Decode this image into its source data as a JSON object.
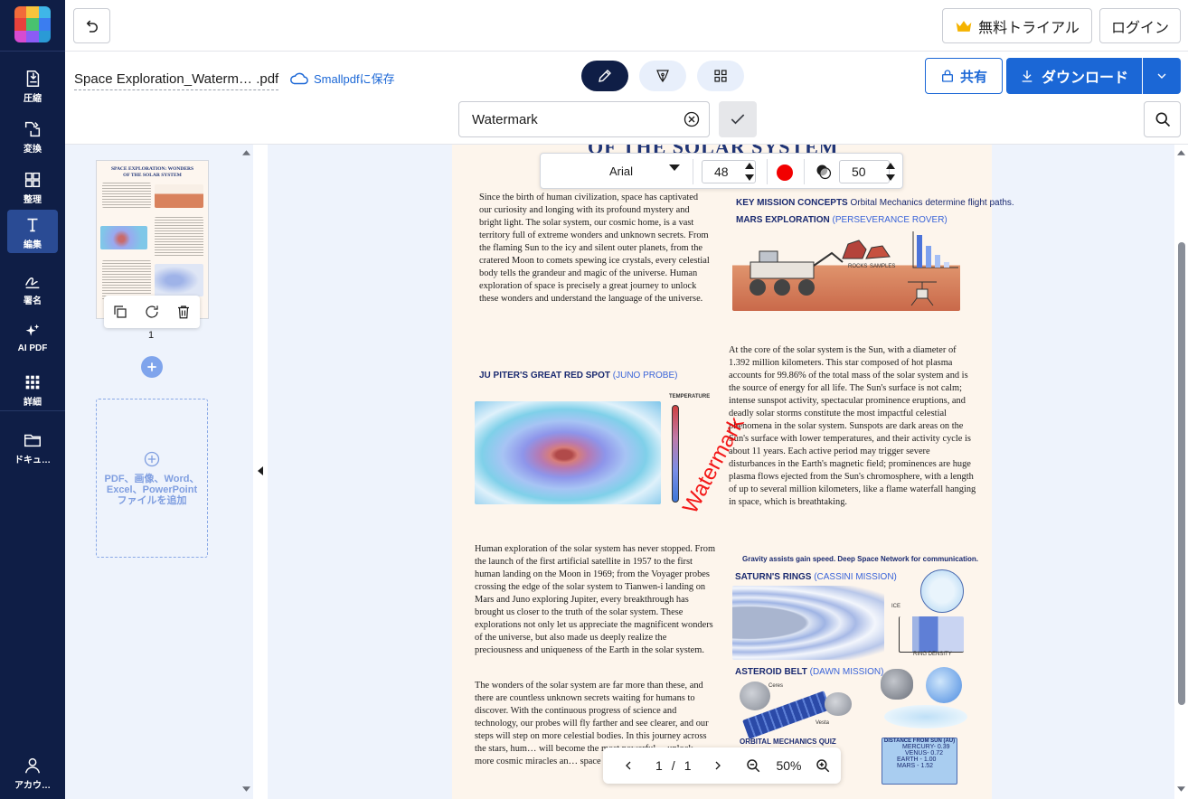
{
  "nav": {
    "items": [
      {
        "label": "圧縮",
        "icon": "compress-icon"
      },
      {
        "label": "変換",
        "icon": "convert-icon"
      },
      {
        "label": "整理",
        "icon": "organize-icon"
      },
      {
        "label": "編集",
        "icon": "edit-icon",
        "active": true
      },
      {
        "label": "署名",
        "icon": "sign-icon"
      },
      {
        "label": "AI PDF",
        "icon": "ai-sparkle-icon"
      },
      {
        "label": "詳細",
        "icon": "more-grid-icon"
      },
      {
        "label": "ドキュ…",
        "icon": "folder-icon"
      }
    ],
    "account_label": "アカウ…"
  },
  "topbar": {
    "trial_label": "無料トライアル",
    "login_label": "ログイン"
  },
  "file": {
    "name": "Space Exploration_Waterm… .pdf",
    "save_label": "Smallpdfに保存"
  },
  "actions": {
    "share_label": "共有",
    "download_label": "ダウンロード"
  },
  "watermark": {
    "value": "Watermark",
    "rendered_text": "Watermark"
  },
  "format": {
    "font": "Arial",
    "size": "48",
    "color": "#f20000",
    "opacity": "50"
  },
  "thumbs": {
    "page_number": "1",
    "add_label": "PDF、画像、Word、Excel、PowerPointファイルを追加"
  },
  "pager": {
    "current": "1",
    "separator": "/",
    "total": "1",
    "zoom": "50%"
  },
  "doc": {
    "title": "OF THE SOLAR SYSTEM",
    "thumb_title": "SPACE EXPLORATION: WONDERS OF THE SOLAR SYSTEM",
    "para1": "Since the birth of human civilization, space has captivated our curiosity and longing with its profound mystery and bright light. The solar system, our cosmic home, is a vast territory full of extreme wonders and unknown secrets. From the flaming Sun to the icy and silent outer planets, from the cratered Moon to comets spewing ice crystals, every celestial body tells the grandeur and magic of the universe. Human exploration of space is precisely a great journey to unlock these wonders and understand the language of the universe.",
    "para2": "At the core of the solar system is the Sun, with a diameter of 1.392 million kilometers. This star composed of hot plasma accounts for 99.86% of the total mass of the solar system and is the source of energy for all life. The Sun's surface is not calm; intense sunspot activity, spectacular prominence eruptions, and deadly solar storms constitute the most impactful celestial phenomena in the solar system. Sunspots are dark areas on the Sun's surface with lower temperatures, and their activity cycle is about 11 years. Each active period may trigger severe disturbances in the Earth's magnetic field; prominences are huge plasma flows ejected from the Sun's chromosphere, with a length of up to several million kilometers, like a flame waterfall hanging in space, which is breathtaking.",
    "para3": "Human exploration of the solar system has never stopped. From the launch of the first artificial satellite in 1957 to the first human landing on the Moon in 1969; from the Voyager probes crossing the edge of the solar system to Tianwen-i landing on Mars and Juno exploring Jupiter, every breakthrough has brought us closer to the truth of the solar system. These explorations not only let us appreciate the magnificent wonders of the universe, but also made us deeply realize the preciousness and uniqueness of the Earth in the solar system.",
    "para4": "The wonders of the solar system are far more than these, and there are countless unknown secrets waiting for humans to discover. With the continuous progress of science and technology, our probes will fly farther and see clearer, and our steps will step on more celestial bodies. In this journey across the stars, hum… will become the most powerful… unlock more cosmic miracles an… space exploration.",
    "h_key": "KEY MISSION CONCEPTS",
    "h_key_sub": "Orbital Mechanics determine flight paths.",
    "h_mars": "MARS EXPLORATION",
    "h_mars_sub": "(PERSEVERANCE ROVER)",
    "h_rocks": "ROCKS",
    "h_samples": "SAMPLES",
    "h_jup": "JU PITER'S GREAT RED SPOT",
    "h_jup_sub": "(JUNO PROBE)",
    "h_temp": "TEMPERATURE",
    "h_gravity": "Gravity assists gain speed. Deep Space Network for communication.",
    "h_saturn": "SATURN'S RINGS",
    "h_saturn_sub": "(CASSINI MISSION)",
    "h_ring": "RING DENSITY",
    "h_ice": "ICE",
    "h_asteroid": "ASTEROID BELT",
    "h_asteroid_sub": "(DAWN MISSION)",
    "h_ceres": "Ceres",
    "h_vesta": "Vesta",
    "h_quiz": "ORBITAL MECHANICS QUIZ",
    "h_dist": "DISTANCE FROM SUN (AU)",
    "dist_rows": [
      "MERCURY- 0.39",
      "VENUS- 0.72",
      "EARTH - 1.00",
      "MARS - 1.52"
    ]
  }
}
